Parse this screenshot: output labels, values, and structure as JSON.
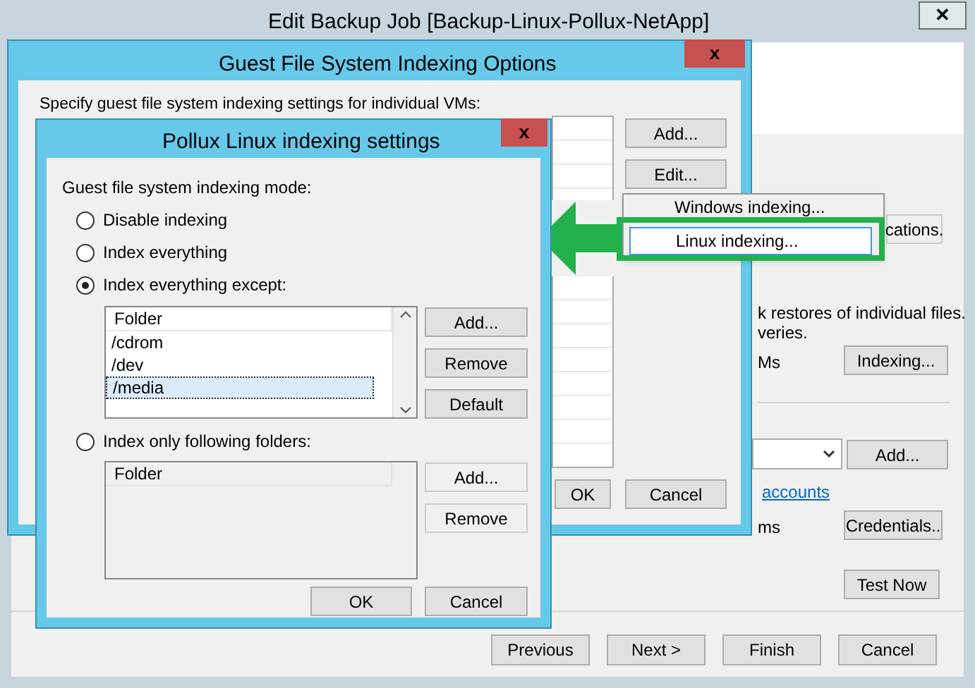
{
  "main_window": {
    "title": "Edit Backup Job [Backup-Linux-Pollux-NetApp]",
    "close": "✕",
    "panel_texts": [
      {
        "text": "k restores of individual files."
      },
      {
        "text": "veries."
      },
      {
        "text": "Ms"
      },
      {
        "text": "ms"
      }
    ],
    "applications_button": {
      "label": "cations.",
      "disabled": true
    },
    "indexing_button": "Indexing...",
    "add_button": "Add...",
    "link": "accounts",
    "credentials_button": "Credentials..",
    "test_button": "Test Now",
    "footer_buttons": [
      "Previous",
      "Next >",
      "Finish",
      "Cancel"
    ]
  },
  "guest_window": {
    "title": "Guest File System Indexing Options",
    "close": "x",
    "instruction": "Specify guest file system indexing settings for individual VMs:",
    "side_buttons": [
      "Add...",
      "Edit..."
    ],
    "ok": "OK",
    "cancel": "Cancel"
  },
  "edit_menu": {
    "items": [
      {
        "label": "Windows indexing...",
        "selected": false
      },
      {
        "label": "Linux indexing...",
        "selected": true
      }
    ]
  },
  "pollux_window": {
    "title": "Pollux Linux indexing settings",
    "close": "x",
    "mode_label": "Guest file system indexing mode:",
    "modes": [
      {
        "label": "Disable indexing",
        "selected": false,
        "kind": "plain"
      },
      {
        "label": "Index everything",
        "selected": false,
        "kind": "plain"
      },
      {
        "label": "Index everything except:",
        "selected": true,
        "kind": "list"
      },
      {
        "label": "Index only following folders:",
        "selected": false,
        "kind": "list"
      }
    ],
    "lists": [
      {
        "header": "Folder",
        "rows": [
          {
            "text": "/cdrom",
            "selected": false
          },
          {
            "text": "/dev",
            "selected": false
          },
          {
            "text": "/media",
            "selected": true
          }
        ],
        "buttons": [
          {
            "label": "Add...",
            "disabled": false
          },
          {
            "label": "Remove",
            "disabled": false
          },
          {
            "label": "Default",
            "disabled": false
          }
        ]
      },
      {
        "header": "Folder",
        "buttons": [
          {
            "label": "Add...",
            "disabled": true
          },
          {
            "label": "Remove",
            "disabled": true
          }
        ]
      }
    ],
    "ok": "OK",
    "cancel": "Cancel"
  }
}
